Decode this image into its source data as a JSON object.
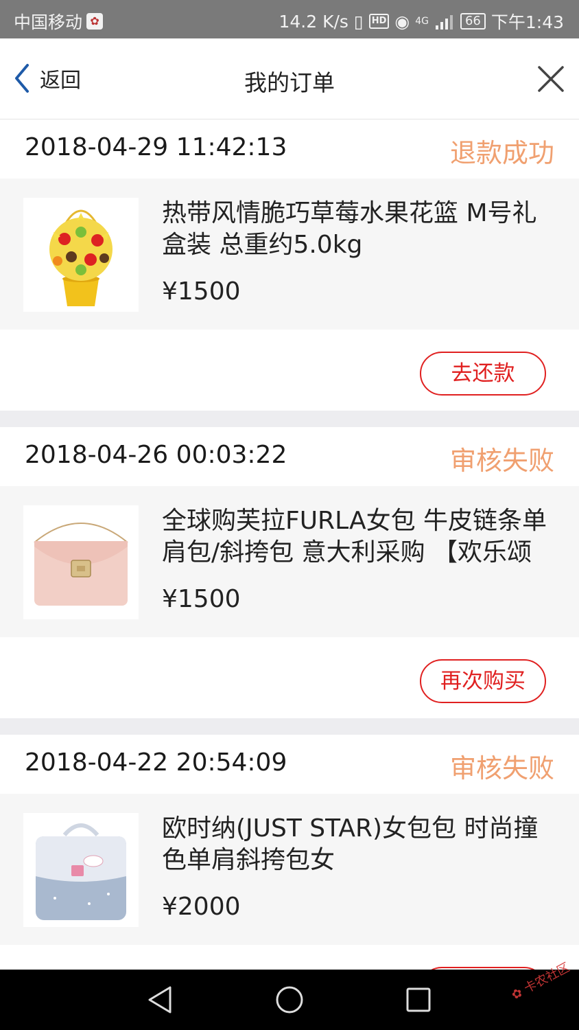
{
  "status_bar": {
    "carrier": "中国移动",
    "net_speed": "14.2 K/s",
    "hd": "HD",
    "signal": "4G",
    "battery": "66",
    "time": "下午1:43"
  },
  "navbar": {
    "back_label": "返回",
    "title": "我的订单"
  },
  "orders": [
    {
      "time": "2018-04-29 11:42:13",
      "status": "退款成功",
      "name_line1": "热带风情脆巧草莓水果花篮 M号礼",
      "name_line2": "盒装 总重约5.0kg",
      "price": "¥1500",
      "action": "去还款"
    },
    {
      "time": "2018-04-26 00:03:22",
      "status": "审核失败",
      "name_line1": "全球购芙拉FURLA女包 牛皮链条单",
      "name_line2": "肩包/斜挎包 意大利采购 【欢乐颂",
      "price": "¥1500",
      "action": "再次购买"
    },
    {
      "time": "2018-04-22 20:54:09",
      "status": "审核失败",
      "name_line1": "欧时纳(JUST STAR)女包包 时尚撞",
      "name_line2": "色单肩斜挎包女",
      "price": "¥2000"
    }
  ],
  "colors": {
    "status": "#f0a070",
    "action": "#e02020",
    "divider": "#ededf0"
  }
}
